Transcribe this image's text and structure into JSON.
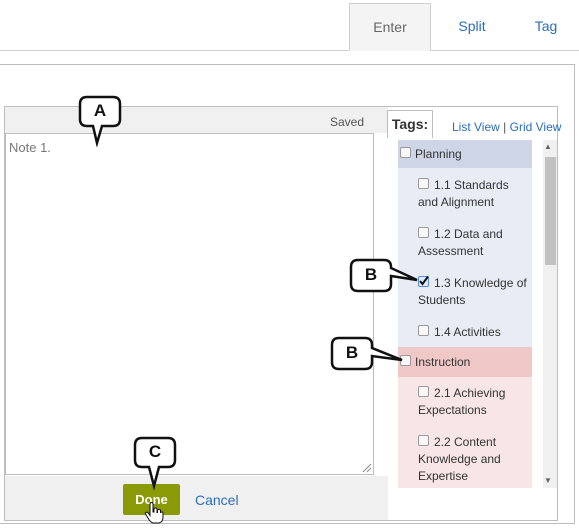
{
  "tabs": [
    {
      "label": "Enter",
      "active": true
    },
    {
      "label": "Split",
      "active": false
    },
    {
      "label": "Tag",
      "active": false
    }
  ],
  "editor": {
    "status": "Saved",
    "note_text": "Note 1.",
    "done_label": "Done",
    "cancel_label": "Cancel"
  },
  "tags_panel": {
    "title": "Tags:",
    "list_view": "List View",
    "separator": "|",
    "grid_view": "Grid View",
    "items": [
      {
        "label": "Planning",
        "type": "category",
        "checked": false
      },
      {
        "label": "1.1 Standards and Alignment",
        "type": "tag",
        "checked": false
      },
      {
        "label": "1.2 Data and Assessment",
        "type": "tag",
        "checked": false
      },
      {
        "label": "1.3 Knowledge of Students",
        "type": "tag",
        "checked": true
      },
      {
        "label": "1.4 Activities",
        "type": "tag",
        "checked": false
      },
      {
        "label": "Instruction",
        "type": "category",
        "checked": false
      },
      {
        "label": "2.1 Achieving Expectations",
        "type": "tag",
        "checked": false
      },
      {
        "label": "2.2 Content Knowledge and Expertise",
        "type": "tag",
        "checked": false
      }
    ]
  },
  "callouts": [
    "A",
    "B",
    "B",
    "C"
  ],
  "colors": {
    "link": "#2a6ebb",
    "done_button": "#8a9a06",
    "planning_header": "#cdd5e6",
    "instruction_header": "#f0c8c8"
  }
}
